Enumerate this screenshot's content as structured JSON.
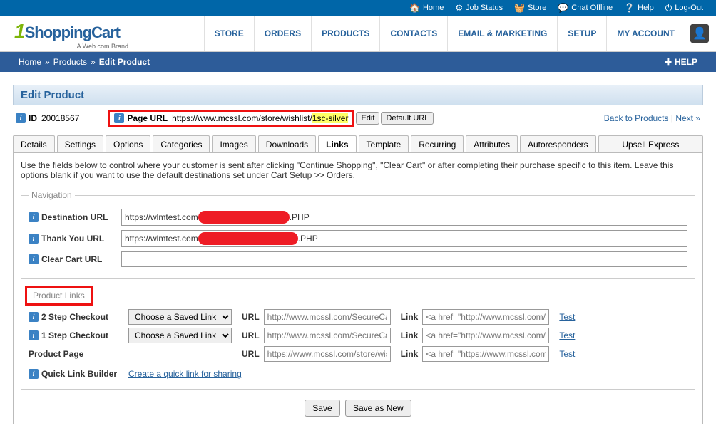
{
  "topbar": {
    "home": "Home",
    "job_status": "Job Status",
    "store": "Store",
    "chat": "Chat Offline",
    "help": "Help",
    "logout": "Log-Out"
  },
  "logo": {
    "brand_prefix": "1",
    "brand": "ShoppingCart",
    "tag": "A Web.com Brand"
  },
  "nav": {
    "store": "STORE",
    "orders": "ORDERS",
    "products": "PRODUCTS",
    "contacts": "CONTACTS",
    "email_marketing": "EMAIL & MARKETING",
    "setup": "SETUP",
    "my_account": "MY ACCOUNT"
  },
  "breadcrumb": {
    "home": "Home",
    "products": "Products",
    "edit": "Edit Product",
    "help": "HELP"
  },
  "panel": {
    "title": "Edit Product"
  },
  "meta": {
    "id_label": "ID",
    "id_value": "20018567",
    "page_url_label": "Page URL",
    "page_url_prefix": "https://www.mcssl.com/store/wishlist/",
    "page_url_highlight": "1sc-silver",
    "edit_btn": "Edit",
    "default_btn": "Default URL",
    "back": "Back to Products",
    "next": "Next »"
  },
  "tabs": {
    "details": "Details",
    "settings": "Settings",
    "options": "Options",
    "categories": "Categories",
    "images": "Images",
    "downloads": "Downloads",
    "links": "Links",
    "template": "Template",
    "recurring": "Recurring",
    "attributes": "Attributes",
    "autoresponders": "Autoresponders",
    "upsell": "Upsell Express"
  },
  "help_text": "Use the fields below to control where your customer is sent after clicking \"Continue Shopping\", \"Clear Cart\" or after completing their purchase specific to this item. Leave this options blank if you want to use the default destinations set under Cart Setup >> Orders.",
  "nav_fieldset": {
    "legend": "Navigation",
    "dest_label": "Destination URL",
    "dest_value_pre": "https://wlmtest.com",
    "dest_value_post": ".PHP",
    "thank_label": "Thank You URL",
    "thank_value_pre": "https://wlmtest.com",
    "thank_value_post": ".PHP",
    "clear_label": "Clear Cart URL",
    "clear_value": ""
  },
  "links_fieldset": {
    "legend": "Product Links",
    "two_step": "2 Step Checkout",
    "one_step": "1 Step Checkout",
    "product_page": "Product Page",
    "choose": "Choose a Saved Link",
    "url_label": "URL",
    "link_label": "Link",
    "test": "Test",
    "url_secure_placeholder": "http://www.mcssl.com/SecureCart",
    "link_secure_placeholder": "<a href=\"http://www.mcssl.com/S",
    "url_store_placeholder": "https://www.mcssl.com/store/wish",
    "link_store_placeholder": "<a href=\"https://www.mcssl.com/",
    "quick_link": "Quick Link Builder",
    "create_link": "Create a quick link for sharing"
  },
  "buttons": {
    "save": "Save",
    "save_new": "Save as New"
  }
}
